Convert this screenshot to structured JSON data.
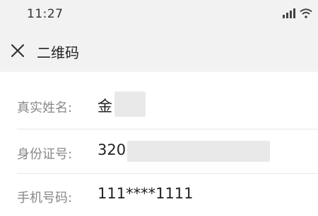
{
  "status_bar": {
    "time": "11:27",
    "icons": [
      "signal-icon",
      "wifi-icon"
    ]
  },
  "header": {
    "close_icon": "close-icon",
    "title": "二维码"
  },
  "rows": [
    {
      "label": "真实姓名:",
      "value": "金"
    },
    {
      "label": "身份证号:",
      "value": "320"
    },
    {
      "label": "手机号码:",
      "value": "111****1111"
    }
  ],
  "colors": {
    "header_bg": "#f2f2f2",
    "label": "#888888",
    "value": "#222222",
    "divider": "#e6e6e6"
  }
}
